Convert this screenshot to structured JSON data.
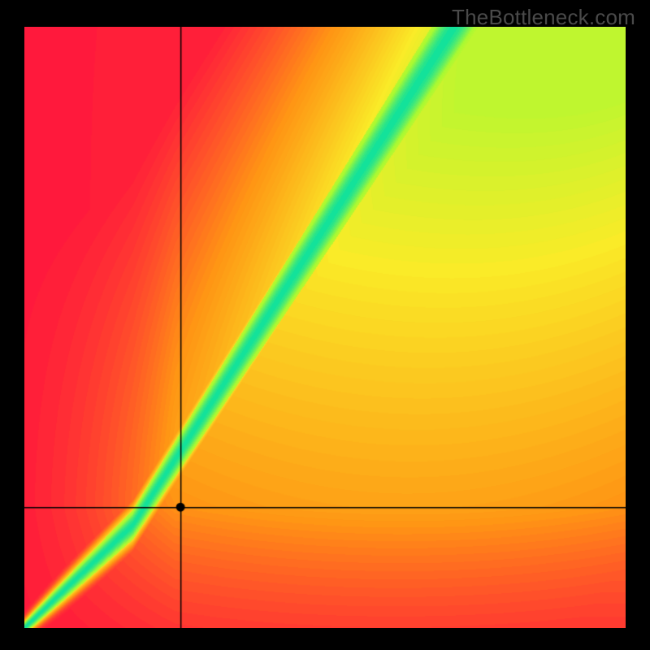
{
  "watermark": "TheBottleneck.com",
  "chart_data": {
    "type": "heatmap",
    "title": "",
    "xlabel": "",
    "ylabel": "",
    "xlim": [
      0,
      100
    ],
    "ylim": [
      0,
      100
    ],
    "crosshair": {
      "x": 26,
      "y": 20
    },
    "marker": {
      "x": 26,
      "y": 20
    },
    "optimal_line": {
      "description": "green narrow band roughly along y ≈ 1.9 * x^1.05 (diagonal slightly steeper than 1:1)",
      "points": [
        [
          0,
          0
        ],
        [
          10,
          9
        ],
        [
          20,
          17
        ],
        [
          30,
          33
        ],
        [
          40,
          50
        ],
        [
          50,
          66
        ],
        [
          60,
          83
        ],
        [
          70,
          100
        ]
      ]
    },
    "colors": {
      "optimal": "#14e29a",
      "near": "#f7f033",
      "warm": "#ff9a1f",
      "worst": "#ff193c"
    },
    "notes": "Bottom-left corner tends red, top-right tends orange/yellow, diagonal is green. Mirrors a bottleneck calculator heatmap."
  }
}
